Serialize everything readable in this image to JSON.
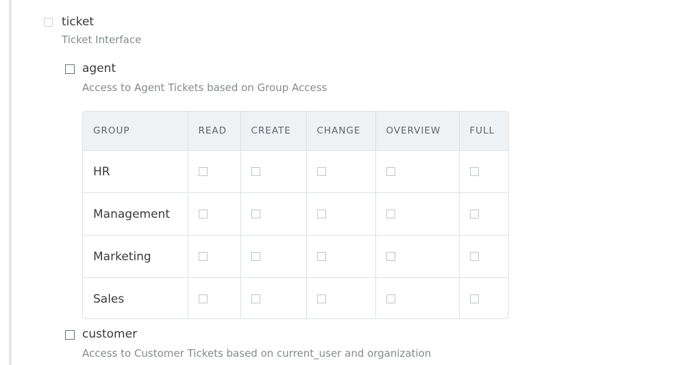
{
  "ticket": {
    "title": "ticket",
    "description": "Ticket Interface"
  },
  "agent": {
    "title": "agent",
    "description": "Access to Agent Tickets based on Group Access"
  },
  "customer": {
    "title": "customer",
    "description": "Access to Customer Tickets based on current_user and organization"
  },
  "group_table": {
    "columns": [
      "GROUP",
      "READ",
      "CREATE",
      "CHANGE",
      "OVERVIEW",
      "FULL"
    ],
    "rows": [
      {
        "group": "HR"
      },
      {
        "group": "Management"
      },
      {
        "group": "Marketing"
      },
      {
        "group": "Sales"
      }
    ]
  }
}
